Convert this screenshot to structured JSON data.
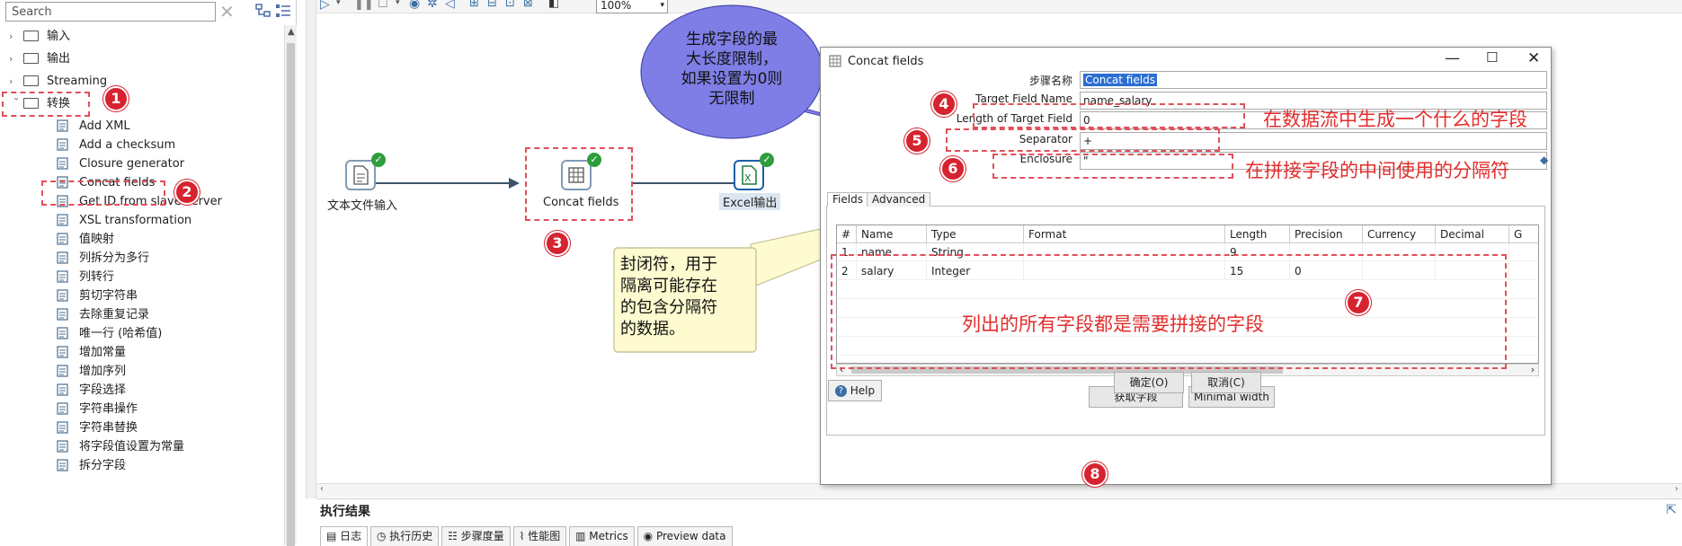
{
  "search": {
    "placeholder": "Search",
    "value": "Search"
  },
  "tree": {
    "folders": [
      {
        "label": "输入",
        "expanded": false
      },
      {
        "label": "输出",
        "expanded": false
      },
      {
        "label": "Streaming",
        "expanded": false
      },
      {
        "label": "转换",
        "expanded": true
      }
    ],
    "items": [
      "Add XML",
      "Add a checksum",
      "Closure generator",
      "Concat fields",
      "Get ID from slave server",
      "XSL transformation",
      "值映射",
      "列拆分为多行",
      "列转行",
      "剪切字符串",
      "去除重复记录",
      "唯一行 (哈希值)",
      "增加常量",
      "增加序列",
      "字段选择",
      "字符串操作",
      "字符串替换",
      "将字段值设置为常量",
      "拆分字段"
    ]
  },
  "toolbar": {
    "zoom": "100%"
  },
  "canvas": {
    "steps": [
      {
        "label": "文本文件输入"
      },
      {
        "label": "Concat fields"
      },
      {
        "label": "Excel输出"
      }
    ]
  },
  "dialog": {
    "title": "Concat fields",
    "step_name_label": "步骤名称",
    "step_name_value": "Concat fields",
    "target_field_label": "Target Field Name",
    "target_field_value": "name_salary",
    "length_label": "Length of Target Field",
    "length_value": "0",
    "separator_label": "Separator",
    "separator_value": "+",
    "enclosure_label": "Enclosure",
    "enclosure_value": "\"",
    "tabs": [
      "Fields",
      "Advanced"
    ],
    "columns": [
      "#",
      "Name",
      "Type",
      "Format",
      "Length",
      "Precision",
      "Currency",
      "Decimal",
      "G"
    ],
    "rows": [
      [
        "1",
        "name",
        "String",
        "",
        "9",
        "",
        "",
        ""
      ],
      [
        "2",
        "salary",
        "Integer",
        "",
        "15",
        "0",
        "",
        ""
      ]
    ],
    "get_fields_button": "获取字段",
    "minimal_width_button": "Minimal width",
    "help_button": "Help",
    "ok_button": "确定(O)",
    "cancel_button": "取消(C)"
  },
  "annotations": {
    "badges": [
      "1",
      "2",
      "3",
      "4",
      "5",
      "6",
      "7",
      "8"
    ],
    "note_target": "在数据流中生成一个什么的字段",
    "note_separator": "在拼接字段的中间使用的分隔符",
    "note_fields": "列出的所有字段都是需要拼接的字段",
    "bubble_length": "生成字段的最\n大长度限制，\n如果设置为0则\n无限制",
    "bubble_enclosure": "封闭符，用于\n隔离可能存在\n的包含分隔符\n的数据。"
  },
  "bottom": {
    "title": "执行结果",
    "tabs": [
      "日志",
      "执行历史",
      "步骤度量",
      "性能图",
      "Metrics",
      "Preview data"
    ]
  },
  "colors": {
    "badge_red": "#d6232f",
    "note_red": "#e32d2d",
    "bubble_blue": "#7e7ee6",
    "note_yellow": "#fdfbcf"
  }
}
